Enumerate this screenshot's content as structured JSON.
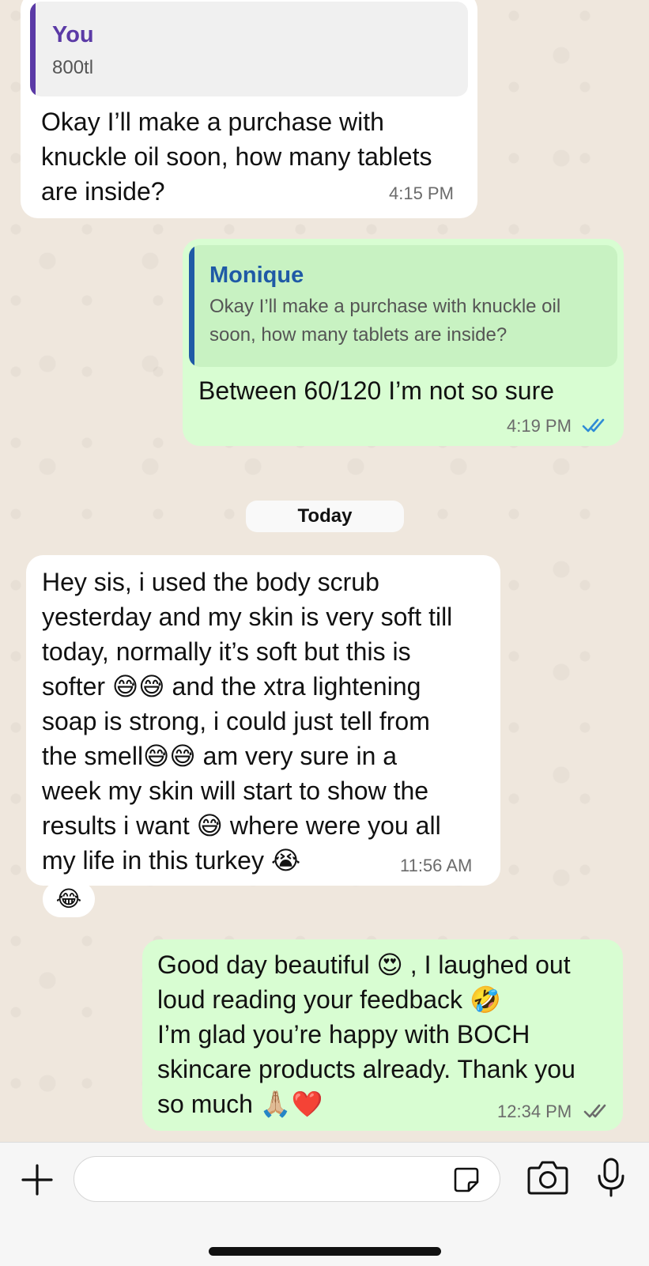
{
  "messages": {
    "m1": {
      "quote_author": "You",
      "quote_text": "800tl",
      "text": "Okay I’ll make a purchase with\nknuckle oil soon, how many tablets\nare inside?",
      "time": "4:15 PM"
    },
    "m2": {
      "quote_author": "Monique",
      "quote_text": "Okay I’ll make a purchase with knuckle oil\nsoon, how many tablets are inside?",
      "text": "Between 60/120 I’m not so sure",
      "time": "4:19 PM",
      "status": "read"
    },
    "date_separator": "Today",
    "m3": {
      "text": "Hey sis, i used the body scrub\nyesterday and my skin is very soft till\ntoday, normally it’s soft but this is\nsofter 😅😅 and the xtra lightening\nsoap is strong, i could just tell from\nthe smell😅😅 am very sure in a\nweek my skin will start to show the\nresults i want 😅 where were you all\nmy life in this turkey 😭",
      "time": "11:56 AM",
      "reaction": "😂"
    },
    "m4": {
      "text": "Good day beautiful 😍 , I laughed out\nloud reading your feedback 🤣\nI’m glad you’re happy with BOCH\nskincare products already. Thank you\nso much 🙏🏼❤️",
      "time": "12:34 PM",
      "status": "delivered"
    }
  },
  "composer": {
    "placeholder": ""
  },
  "icons": {
    "add": "plus-icon",
    "sticker": "sticker-icon",
    "camera": "camera-icon",
    "mic": "microphone-icon"
  },
  "colors": {
    "incoming_bubble": "#ffffff",
    "outgoing_bubble": "#d8fdd2",
    "read_ticks": "#2f8bd6",
    "delivered_ticks": "#6b6b6b"
  }
}
